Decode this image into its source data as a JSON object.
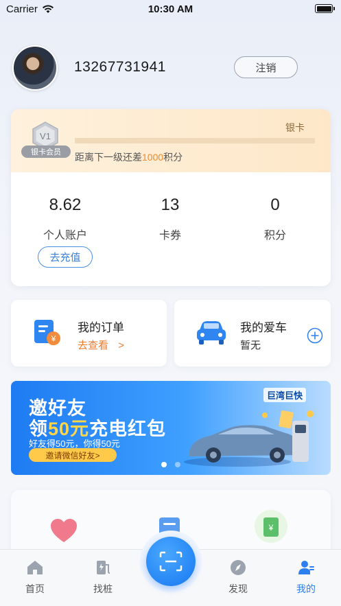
{
  "status_bar": {
    "carrier": "Carrier",
    "time": "10:30 AM"
  },
  "profile": {
    "phone": "13267731941",
    "logout_label": "注销"
  },
  "member": {
    "badge_level": "V1",
    "badge_label": "银卡会员",
    "level_name": "银卡",
    "hint_prefix": "距离下一级还差",
    "hint_points": "1000",
    "hint_suffix": "积分",
    "progress": 0.0
  },
  "stats": [
    {
      "value": "8.62",
      "label": "个人账户"
    },
    {
      "value": "13",
      "label": "卡券"
    },
    {
      "value": "0",
      "label": "积分"
    }
  ],
  "recharge_label": "去充值",
  "orders": {
    "title": "我的订单",
    "link": "去查看",
    "icon": "order-receipt-icon"
  },
  "car": {
    "title": "我的爱车",
    "status": "暂无",
    "icon": "car-icon"
  },
  "banner": {
    "title_line1": "邀好友",
    "title_line2_prefix": "领",
    "title_line2_highlight": "50元",
    "title_line2_suffix": "充电红包",
    "subtitle": "好友得50元，你得50元",
    "button": "邀请微信好友>",
    "logo_text": "巨湾巨快",
    "active_dot": 0,
    "dots": 2
  },
  "tabs": [
    {
      "label": "首页",
      "icon": "home-icon",
      "active": false
    },
    {
      "label": "找桩",
      "icon": "charger-icon",
      "active": false
    },
    {
      "label": "发现",
      "icon": "compass-icon",
      "active": false
    },
    {
      "label": "我的",
      "icon": "profile-icon",
      "active": true
    }
  ],
  "colors": {
    "accent": "#2d7ff0",
    "highlight_orange": "#f08a2c",
    "gold": "#e6b878"
  }
}
